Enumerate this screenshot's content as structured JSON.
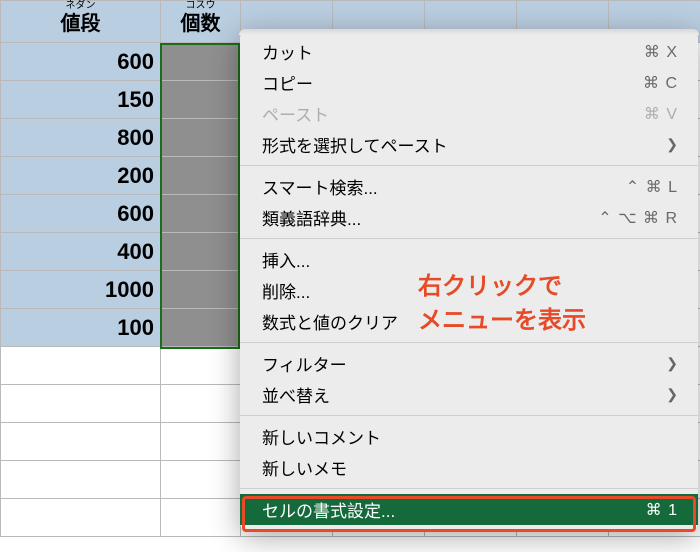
{
  "headers": {
    "col_a": {
      "label": "値段",
      "ruby": "ネダン"
    },
    "col_b": {
      "label": "個数",
      "ruby": "コスウ"
    }
  },
  "rows": [
    "600",
    "150",
    "800",
    "200",
    "600",
    "400",
    "1000",
    "100"
  ],
  "menu": {
    "cut": {
      "label": "カット",
      "shortcut": "⌘ X"
    },
    "copy": {
      "label": "コピー",
      "shortcut": "⌘ C"
    },
    "paste": {
      "label": "ペースト",
      "shortcut": "⌘ V"
    },
    "paste_sp": {
      "label": "形式を選択してペースト"
    },
    "smart": {
      "label": "スマート検索...",
      "shortcut": "⌃ ⌘ L"
    },
    "thes": {
      "label": "類義語辞典...",
      "shortcut": "⌃ ⌥ ⌘ R"
    },
    "insert": {
      "label": "挿入..."
    },
    "delete": {
      "label": "削除..."
    },
    "clear": {
      "label": "数式と値のクリア"
    },
    "filter": {
      "label": "フィルター"
    },
    "sort": {
      "label": "並べ替え"
    },
    "comment": {
      "label": "新しいコメント"
    },
    "memo": {
      "label": "新しいメモ"
    },
    "format": {
      "label": "セルの書式設定...",
      "shortcut": "⌘ 1"
    }
  },
  "annotation": {
    "line1": "右クリックで",
    "line2": "メニューを表示"
  }
}
